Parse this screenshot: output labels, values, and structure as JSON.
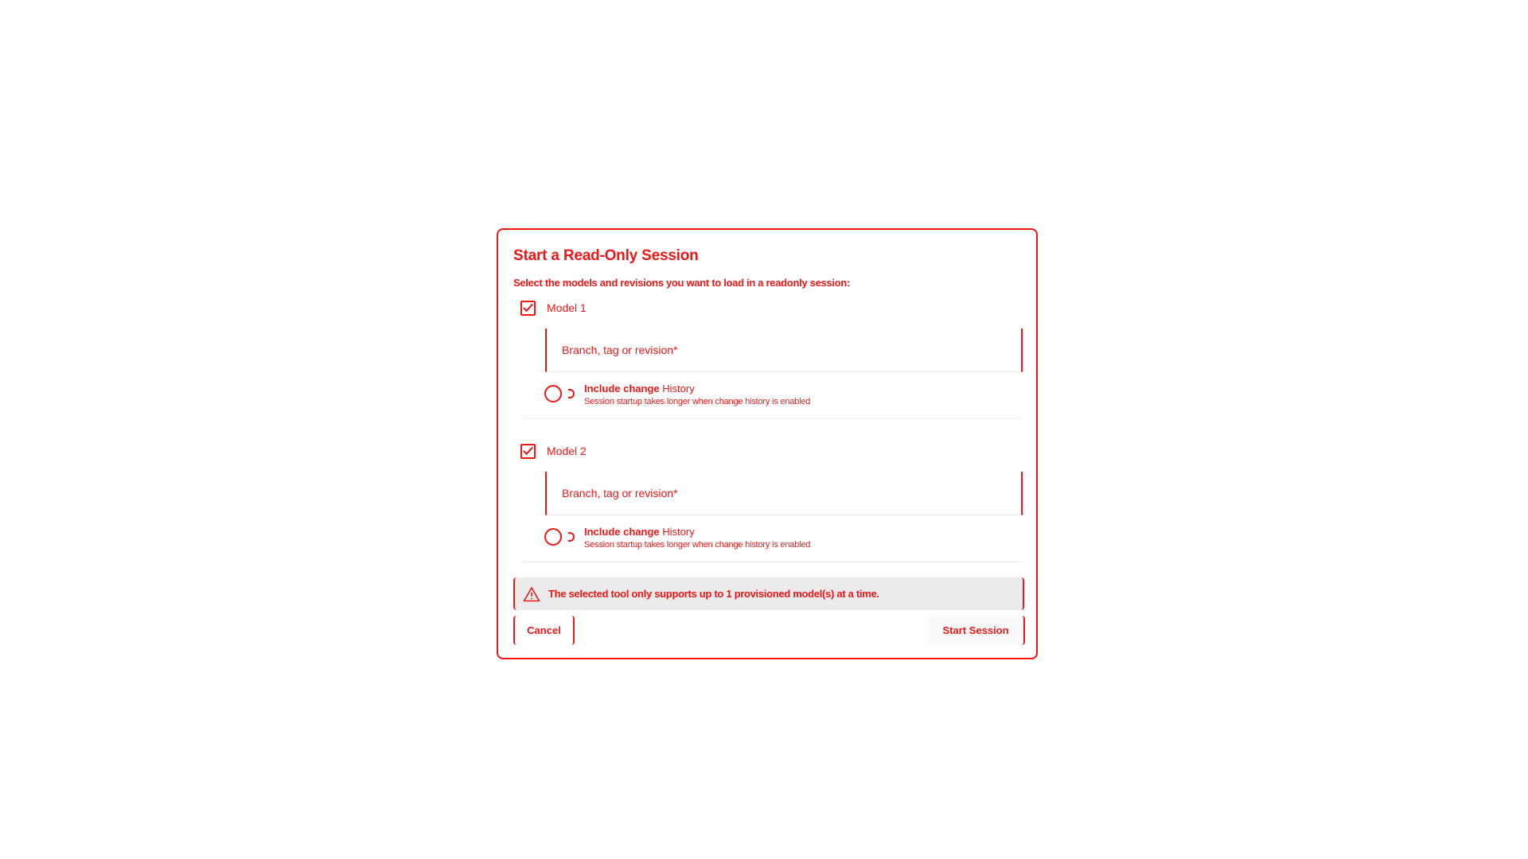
{
  "dialog": {
    "title": "Start a Read-Only Session",
    "subtitle": "Select the models and revisions you want to load in a readonly session:",
    "models": [
      {
        "name": "Model 1",
        "checked": true,
        "revision_placeholder": "Branch, tag or revision*",
        "history_label_bold": "Include change",
        "history_label_rest": " History",
        "history_description": "Session startup takes longer when change history is enabled",
        "history_enabled": false
      },
      {
        "name": "Model 2",
        "checked": true,
        "revision_placeholder": "Branch, tag or revision*",
        "history_label_bold": "Include change",
        "history_label_rest": " History",
        "history_description": "Session startup takes longer when change history is enabled",
        "history_enabled": false
      }
    ],
    "warning": "The selected tool only supports up to 1 provisioned model(s) at a time.",
    "warning_icon": "warning-triangle-icon",
    "cancel_label": "Cancel",
    "start_label": "Start Session"
  },
  "colors": {
    "accent": "#f01616",
    "warning_bg": "#ebebeb"
  }
}
